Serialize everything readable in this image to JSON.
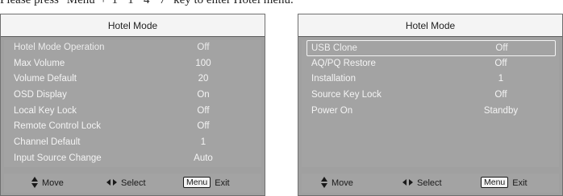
{
  "instruction": "Please press \"Menu\"+\"1\"\"1\"\"4\"\"7\" key to enter Hotel menu.",
  "panels": [
    {
      "title": "Hotel Mode",
      "items": [
        {
          "label": "Hotel Mode Operation",
          "value": "Off",
          "selected": true
        },
        {
          "label": "Max Volume",
          "value": "100"
        },
        {
          "label": "Volume Default",
          "value": "20"
        },
        {
          "label": "OSD Display",
          "value": "On"
        },
        {
          "label": "Local Key Lock",
          "value": "Off"
        },
        {
          "label": "Remote Control Lock",
          "value": "Off"
        },
        {
          "label": "Channel Default",
          "value": "1"
        },
        {
          "label": "Input Source Change",
          "value": "Auto"
        }
      ],
      "footer": {
        "move": "Move",
        "select": "Select",
        "menu_key": "Menu",
        "exit": "Exit"
      }
    },
    {
      "title": "Hotel Mode",
      "items": [
        {
          "label": "USB Clone",
          "value": "Off",
          "selected": true
        },
        {
          "label": "AQ/PQ Restore",
          "value": "Off"
        },
        {
          "label": "Installation",
          "value": "1"
        },
        {
          "label": "Source Key Lock",
          "value": "Off"
        },
        {
          "label": "Power On",
          "value": "Standby"
        }
      ],
      "footer": {
        "move": "Move",
        "select": "Select",
        "menu_key": "Menu",
        "exit": "Exit"
      }
    }
  ],
  "icons": {
    "move": "up-down-arrows-icon",
    "select": "left-right-arrows-icon"
  }
}
